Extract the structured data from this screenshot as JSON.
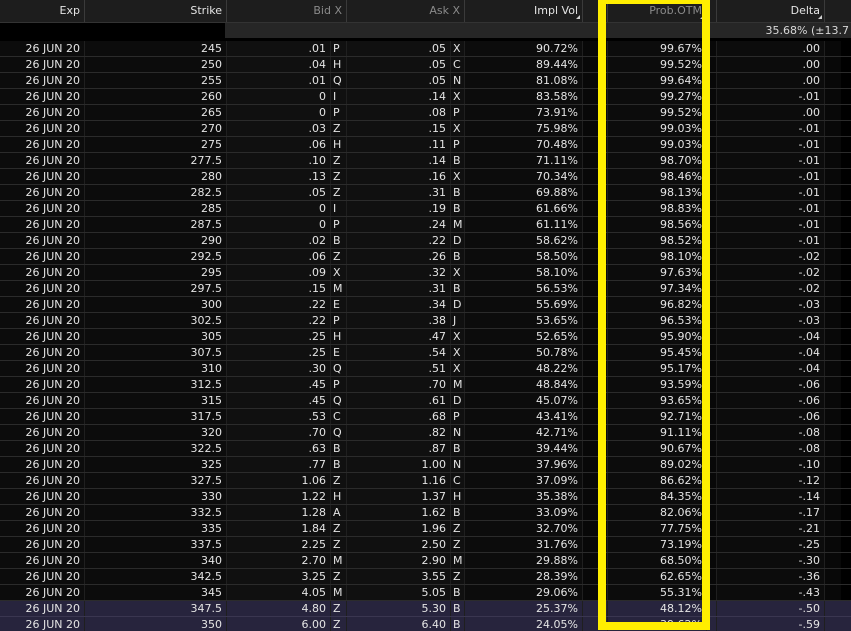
{
  "columns": {
    "exp": "Exp",
    "strike": "Strike",
    "bid_x": "Bid X",
    "ask_x": "Ask X",
    "impl_vol": "Impl Vol",
    "prob_otm": "Prob.OTM",
    "delta": "Delta"
  },
  "summary": {
    "impl_vol": "35.68% (±13.7"
  },
  "colors": {
    "highlight_box": "#ffee00",
    "itm_row": "#27243d",
    "background": "#000000"
  },
  "rows": [
    {
      "exp": "26 JUN 20",
      "strike": "245",
      "bid": ".01",
      "bid_x": "P",
      "ask": ".05",
      "ask_x": "X",
      "iv": "90.72%",
      "prob_otm": "99.67%",
      "delta": ".00"
    },
    {
      "exp": "26 JUN 20",
      "strike": "250",
      "bid": ".04",
      "bid_x": "H",
      "ask": ".05",
      "ask_x": "C",
      "iv": "89.44%",
      "prob_otm": "99.52%",
      "delta": ".00"
    },
    {
      "exp": "26 JUN 20",
      "strike": "255",
      "bid": ".01",
      "bid_x": "Q",
      "ask": ".05",
      "ask_x": "N",
      "iv": "81.08%",
      "prob_otm": "99.64%",
      "delta": ".00"
    },
    {
      "exp": "26 JUN 20",
      "strike": "260",
      "bid": "0",
      "bid_x": "I",
      "ask": ".14",
      "ask_x": "X",
      "iv": "83.58%",
      "prob_otm": "99.27%",
      "delta": "-.01"
    },
    {
      "exp": "26 JUN 20",
      "strike": "265",
      "bid": "0",
      "bid_x": "P",
      "ask": ".08",
      "ask_x": "P",
      "iv": "73.91%",
      "prob_otm": "99.52%",
      "delta": ".00"
    },
    {
      "exp": "26 JUN 20",
      "strike": "270",
      "bid": ".03",
      "bid_x": "Z",
      "ask": ".15",
      "ask_x": "X",
      "iv": "75.98%",
      "prob_otm": "99.03%",
      "delta": "-.01"
    },
    {
      "exp": "26 JUN 20",
      "strike": "275",
      "bid": ".06",
      "bid_x": "H",
      "ask": ".11",
      "ask_x": "P",
      "iv": "70.48%",
      "prob_otm": "99.03%",
      "delta": "-.01"
    },
    {
      "exp": "26 JUN 20",
      "strike": "277.5",
      "bid": ".10",
      "bid_x": "Z",
      "ask": ".14",
      "ask_x": "B",
      "iv": "71.11%",
      "prob_otm": "98.70%",
      "delta": "-.01"
    },
    {
      "exp": "26 JUN 20",
      "strike": "280",
      "bid": ".13",
      "bid_x": "Z",
      "ask": ".16",
      "ask_x": "X",
      "iv": "70.34%",
      "prob_otm": "98.46%",
      "delta": "-.01"
    },
    {
      "exp": "26 JUN 20",
      "strike": "282.5",
      "bid": ".05",
      "bid_x": "Z",
      "ask": ".31",
      "ask_x": "B",
      "iv": "69.88%",
      "prob_otm": "98.13%",
      "delta": "-.01"
    },
    {
      "exp": "26 JUN 20",
      "strike": "285",
      "bid": "0",
      "bid_x": "I",
      "ask": ".19",
      "ask_x": "B",
      "iv": "61.66%",
      "prob_otm": "98.83%",
      "delta": "-.01"
    },
    {
      "exp": "26 JUN 20",
      "strike": "287.5",
      "bid": "0",
      "bid_x": "P",
      "ask": ".24",
      "ask_x": "M",
      "iv": "61.11%",
      "prob_otm": "98.56%",
      "delta": "-.01"
    },
    {
      "exp": "26 JUN 20",
      "strike": "290",
      "bid": ".02",
      "bid_x": "B",
      "ask": ".22",
      "ask_x": "D",
      "iv": "58.62%",
      "prob_otm": "98.52%",
      "delta": "-.01"
    },
    {
      "exp": "26 JUN 20",
      "strike": "292.5",
      "bid": ".06",
      "bid_x": "Z",
      "ask": ".26",
      "ask_x": "B",
      "iv": "58.50%",
      "prob_otm": "98.10%",
      "delta": "-.02"
    },
    {
      "exp": "26 JUN 20",
      "strike": "295",
      "bid": ".09",
      "bid_x": "X",
      "ask": ".32",
      "ask_x": "X",
      "iv": "58.10%",
      "prob_otm": "97.63%",
      "delta": "-.02"
    },
    {
      "exp": "26 JUN 20",
      "strike": "297.5",
      "bid": ".15",
      "bid_x": "M",
      "ask": ".31",
      "ask_x": "B",
      "iv": "56.53%",
      "prob_otm": "97.34%",
      "delta": "-.02"
    },
    {
      "exp": "26 JUN 20",
      "strike": "300",
      "bid": ".22",
      "bid_x": "E",
      "ask": ".34",
      "ask_x": "D",
      "iv": "55.69%",
      "prob_otm": "96.82%",
      "delta": "-.03"
    },
    {
      "exp": "26 JUN 20",
      "strike": "302.5",
      "bid": ".22",
      "bid_x": "P",
      "ask": ".38",
      "ask_x": "J",
      "iv": "53.65%",
      "prob_otm": "96.53%",
      "delta": "-.03"
    },
    {
      "exp": "26 JUN 20",
      "strike": "305",
      "bid": ".25",
      "bid_x": "H",
      "ask": ".47",
      "ask_x": "X",
      "iv": "52.65%",
      "prob_otm": "95.90%",
      "delta": "-.04"
    },
    {
      "exp": "26 JUN 20",
      "strike": "307.5",
      "bid": ".25",
      "bid_x": "E",
      "ask": ".54",
      "ask_x": "X",
      "iv": "50.78%",
      "prob_otm": "95.45%",
      "delta": "-.04"
    },
    {
      "exp": "26 JUN 20",
      "strike": "310",
      "bid": ".30",
      "bid_x": "Q",
      "ask": ".51",
      "ask_x": "X",
      "iv": "48.22%",
      "prob_otm": "95.17%",
      "delta": "-.04"
    },
    {
      "exp": "26 JUN 20",
      "strike": "312.5",
      "bid": ".45",
      "bid_x": "P",
      "ask": ".70",
      "ask_x": "M",
      "iv": "48.84%",
      "prob_otm": "93.59%",
      "delta": "-.06"
    },
    {
      "exp": "26 JUN 20",
      "strike": "315",
      "bid": ".45",
      "bid_x": "Q",
      "ask": ".61",
      "ask_x": "D",
      "iv": "45.07%",
      "prob_otm": "93.65%",
      "delta": "-.06"
    },
    {
      "exp": "26 JUN 20",
      "strike": "317.5",
      "bid": ".53",
      "bid_x": "C",
      "ask": ".68",
      "ask_x": "P",
      "iv": "43.41%",
      "prob_otm": "92.71%",
      "delta": "-.06"
    },
    {
      "exp": "26 JUN 20",
      "strike": "320",
      "bid": ".70",
      "bid_x": "Q",
      "ask": ".82",
      "ask_x": "N",
      "iv": "42.71%",
      "prob_otm": "91.11%",
      "delta": "-.08"
    },
    {
      "exp": "26 JUN 20",
      "strike": "322.5",
      "bid": ".63",
      "bid_x": "B",
      "ask": ".87",
      "ask_x": "B",
      "iv": "39.44%",
      "prob_otm": "90.67%",
      "delta": "-.08"
    },
    {
      "exp": "26 JUN 20",
      "strike": "325",
      "bid": ".77",
      "bid_x": "B",
      "ask": "1.00",
      "ask_x": "N",
      "iv": "37.96%",
      "prob_otm": "89.02%",
      "delta": "-.10"
    },
    {
      "exp": "26 JUN 20",
      "strike": "327.5",
      "bid": "1.06",
      "bid_x": "Z",
      "ask": "1.16",
      "ask_x": "C",
      "iv": "37.09%",
      "prob_otm": "86.62%",
      "delta": "-.12"
    },
    {
      "exp": "26 JUN 20",
      "strike": "330",
      "bid": "1.22",
      "bid_x": "H",
      "ask": "1.37",
      "ask_x": "H",
      "iv": "35.38%",
      "prob_otm": "84.35%",
      "delta": "-.14"
    },
    {
      "exp": "26 JUN 20",
      "strike": "332.5",
      "bid": "1.28",
      "bid_x": "A",
      "ask": "1.62",
      "ask_x": "B",
      "iv": "33.09%",
      "prob_otm": "82.06%",
      "delta": "-.17"
    },
    {
      "exp": "26 JUN 20",
      "strike": "335",
      "bid": "1.84",
      "bid_x": "Z",
      "ask": "1.96",
      "ask_x": "Z",
      "iv": "32.70%",
      "prob_otm": "77.75%",
      "delta": "-.21"
    },
    {
      "exp": "26 JUN 20",
      "strike": "337.5",
      "bid": "2.25",
      "bid_x": "Z",
      "ask": "2.50",
      "ask_x": "Z",
      "iv": "31.76%",
      "prob_otm": "73.19%",
      "delta": "-.25"
    },
    {
      "exp": "26 JUN 20",
      "strike": "340",
      "bid": "2.70",
      "bid_x": "M",
      "ask": "2.90",
      "ask_x": "M",
      "iv": "29.88%",
      "prob_otm": "68.50%",
      "delta": "-.30"
    },
    {
      "exp": "26 JUN 20",
      "strike": "342.5",
      "bid": "3.25",
      "bid_x": "Z",
      "ask": "3.55",
      "ask_x": "Z",
      "iv": "28.39%",
      "prob_otm": "62.65%",
      "delta": "-.36"
    },
    {
      "exp": "26 JUN 20",
      "strike": "345",
      "bid": "4.05",
      "bid_x": "M",
      "ask": "5.05",
      "ask_x": "B",
      "iv": "29.06%",
      "prob_otm": "55.31%",
      "delta": "-.43"
    },
    {
      "exp": "26 JUN 20",
      "strike": "347.5",
      "bid": "4.80",
      "bid_x": "Z",
      "ask": "5.30",
      "ask_x": "B",
      "iv": "25.37%",
      "prob_otm": "48.12%",
      "delta": "-.50",
      "itm": true
    },
    {
      "exp": "26 JUN 20",
      "strike": "350",
      "bid": "6.00",
      "bid_x": "Z",
      "ask": "6.40",
      "ask_x": "B",
      "iv": "24.05%",
      "prob_otm": "39.62%",
      "delta": "-.59",
      "itm": true
    }
  ]
}
